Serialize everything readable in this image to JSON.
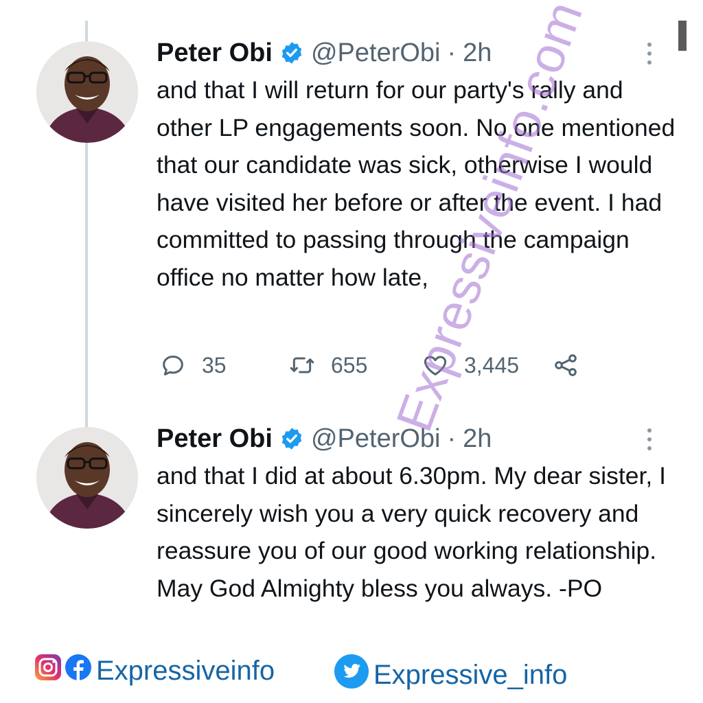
{
  "scrollbar": {},
  "tweets": [
    {
      "author_name": "Peter Obi",
      "handle": "@PeterObi",
      "separator": "·",
      "time": "2h",
      "text": "and that I will return for our party's rally and other LP engagements soon. No one mentioned that our candidate was sick, otherwise I would have visited her before or after the event. I had committed to passing through the campaign office no matter how late,",
      "actions": {
        "replies": "35",
        "retweets": "655",
        "likes": "3,445"
      }
    },
    {
      "author_name": "Peter Obi",
      "handle": "@PeterObi",
      "separator": "·",
      "time": "2h",
      "text": "and that I did at about 6.30pm. My dear sister, I sincerely wish you a very quick recovery and reassure you of our good working relationship. May God Almighty bless you always. -PO"
    }
  ],
  "watermark": "Expressiveinfo.com",
  "footer": {
    "instagram_facebook_label": "Expressiveinfo",
    "twitter_label": "Expressive_info",
    "icons": [
      "instagram-icon",
      "facebook-icon",
      "twitter-bird-icon"
    ]
  },
  "colors": {
    "verified_blue": "#1d9bf0",
    "secondary_text": "#536471",
    "footer_text": "#1665a6",
    "watermark": "#a06ed2"
  }
}
